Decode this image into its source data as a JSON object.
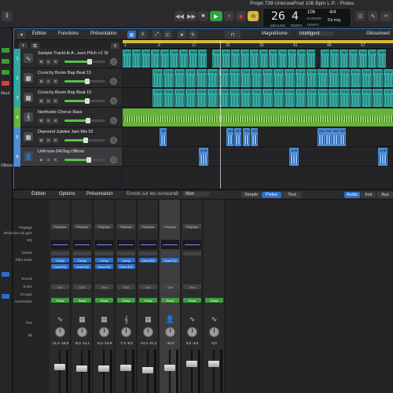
{
  "window": {
    "title": "Projet 739 UnknowProd 106 Bpm L.P. - Pistes"
  },
  "transport": {
    "rewind_icon": "rewind-icon",
    "forward_icon": "fast-forward-icon",
    "stop_icon": "stop-icon",
    "play_icon": "play-icon",
    "record_icon": "record-icon",
    "cycle_icon": "cycle-icon",
    "bar": "26",
    "beat": "4",
    "tempo": "106",
    "tempo_label": "GARDER",
    "time_sig": "4/4",
    "key": "Do maj",
    "bar_label": "MESURE",
    "beat_label": "TEMPS",
    "tempo_unit": "TEMPO"
  },
  "sidebar": {
    "fragments": [
      "éfaut",
      "Officiel"
    ]
  },
  "arrange": {
    "menus": {
      "edit": "Édition",
      "functions": "Fonctions",
      "presentation": "Présentation",
      "magnetism": "Magnétisme :",
      "magnetism_value": "Intelligent",
      "slide": "Glissement"
    },
    "ruler_bars": [
      "1",
      "9",
      "17",
      "25",
      "33",
      "41",
      "49",
      "57",
      "65"
    ],
    "tracks": [
      {
        "number": "1",
        "name": "Sample TrackLib A...eurs Pitch +2 St",
        "color": "#2fa8a0",
        "icon": "waveform-icon",
        "volume": 0.62
      },
      {
        "number": "2",
        "name": "Crunchy Boom Bap Beat 15",
        "color": "#2fa8a0",
        "icon": "drum-machine-icon",
        "volume": 0.55
      },
      {
        "number": "3",
        "name": "Crunchy Boom Bap Beat 15",
        "color": "#2fa8a0",
        "icon": "drum-machine-icon",
        "volume": 0.55
      },
      {
        "number": "4",
        "name": "Northside Chorus Bass",
        "color": "#66b33a",
        "icon": "guitar-icon",
        "volume": 0.58
      },
      {
        "number": "5",
        "name": "Diamond Jubilee Jam Mix 02",
        "color": "#4d8ed6",
        "icon": "drum-machine-icon",
        "volume": 0.52
      },
      {
        "number": "6",
        "name": "UnKnow-24bTag Officiel",
        "color": "#4d8ed6",
        "icon": "person-icon",
        "volume": 0.6
      }
    ],
    "region_labels": {
      "sample": "Sam",
      "sample_full": "Sample",
      "crunchy": "Crunc",
      "diamond": "Dia",
      "unknow": "UnK"
    }
  },
  "mixer": {
    "menus": {
      "edit": "Édition",
      "options": "Options",
      "presentation": "Présentation",
      "cursor_sends": "Envois sur les curseurs :",
      "cursor_sends_value": "Non"
    },
    "view_tabs": [
      "Simple",
      "Pistes",
      "Tout"
    ],
    "active_view": "Pistes",
    "filter_tabs": [
      "Audio",
      "Inst",
      "Aux"
    ],
    "row_labels": {
      "setting": "Réglage",
      "gain": "Réduction du gain",
      "eq": "EQ",
      "input": "Entrée",
      "fx": "Effet audio",
      "sends": "Envois",
      "output": "Sortie",
      "group": "Groupe",
      "automation": "Automation",
      "pan": "Pan",
      "db": "dB"
    },
    "strips": [
      {
        "setting": "Réglage",
        "fx": [
          "Comp",
          "Chan EQ"
        ],
        "output": "Out",
        "automation": "Read",
        "icon": "waveform-icon",
        "db": "-11,4  -16,0",
        "fader": 0.62
      },
      {
        "setting": "Réglage",
        "fx": [
          "Comp",
          "Chan EQ"
        ],
        "output": "Out",
        "automation": "Read",
        "icon": "drum-machine-icon",
        "db": "-9,3  -11,1",
        "fader": 0.58
      },
      {
        "setting": "Réglage",
        "fx": [
          "Comp",
          "Chan EQ"
        ],
        "output": "Out",
        "automation": "Read",
        "icon": "drum-machine-icon",
        "db": "-9,3  -10,9",
        "fader": 0.58
      },
      {
        "setting": "Réglage",
        "fx": [
          "Comp",
          "Chan EQ"
        ],
        "output": "Out",
        "automation": "Read",
        "icon": "guitar-icon",
        "db": "-7,4  -8,0",
        "fader": 0.6
      },
      {
        "setting": "Réglage",
        "fx": [
          "Chan EQ"
        ],
        "output": "Out",
        "automation": "Read",
        "icon": "drum-machine-icon",
        "db": "-14,4  -21,2",
        "fader": 0.55
      },
      {
        "setting": "Réglage",
        "fx": [
          "Chan EQ"
        ],
        "output": "Out",
        "automation": "Read",
        "icon": "person-icon",
        "db": "-10,0",
        "fader": 0.6
      },
      {
        "setting": "Réglage",
        "fx": [],
        "output": "Out",
        "automation": "Read",
        "icon": "waveform-icon",
        "db": "0,0  -3,5",
        "fader": 0.7
      },
      {
        "setting": "",
        "fx": [],
        "output": "",
        "automation": "Read",
        "icon": "waveform-icon",
        "db": "0,0",
        "fader": 0.7
      }
    ]
  }
}
